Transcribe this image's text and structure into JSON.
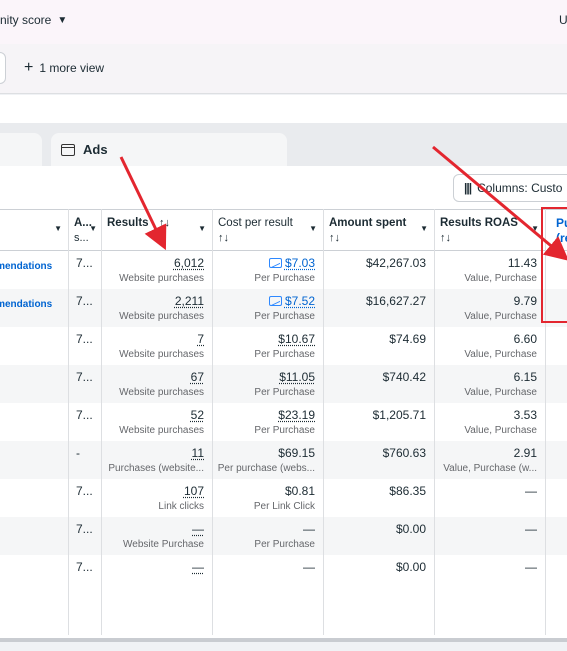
{
  "topbar": {
    "score_label": "nity score",
    "right_text": "U"
  },
  "views": {
    "more_views": "1 more view"
  },
  "tabs": {
    "ads_label": "Ads"
  },
  "toolbar": {
    "columns_label": "Columns: Custo"
  },
  "columns": [
    {
      "key": "name",
      "label": ""
    },
    {
      "key": "a",
      "label": "A...",
      "sub": "s..."
    },
    {
      "key": "results",
      "label": "Results",
      "sort": "↑↓"
    },
    {
      "key": "cpr",
      "label": "Cost per result",
      "sort": "↑↓"
    },
    {
      "key": "spent",
      "label": "Amount spent",
      "sort": "↑↓"
    },
    {
      "key": "roas",
      "label": "Results ROAS",
      "sort": "↑↓"
    },
    {
      "key": "pu",
      "label": "Pu",
      "sub": "(re"
    }
  ],
  "rows": [
    {
      "rec": "nmendations",
      "a": "7...",
      "results": "6,012",
      "results_sub": "Website purchases",
      "cpr": "$7.03",
      "cpr_sub": "Per Purchase",
      "cpr_link": true,
      "spent": "$42,267.03",
      "roas": "11.43",
      "roas_sub": "Value, Purchase"
    },
    {
      "rec": "nmendations",
      "a": "7...",
      "results": "2,211",
      "results_sub": "Website purchases",
      "cpr": "$7.52",
      "cpr_sub": "Per Purchase",
      "cpr_link": true,
      "spent": "$16,627.27",
      "roas": "9.79",
      "roas_sub": "Value, Purchase"
    },
    {
      "rec": "",
      "a": "7...",
      "results": "7",
      "results_sub": "Website purchases",
      "cpr": "$10.67",
      "cpr_sub": "Per Purchase",
      "spent": "$74.69",
      "roas": "6.60",
      "roas_sub": "Value, Purchase"
    },
    {
      "rec": "",
      "a": "7...",
      "results": "67",
      "results_sub": "Website purchases",
      "cpr": "$11.05",
      "cpr_sub": "Per Purchase",
      "spent": "$740.42",
      "roas": "6.15",
      "roas_sub": "Value, Purchase"
    },
    {
      "rec": "",
      "a": "7...",
      "results": "52",
      "results_sub": "Website purchases",
      "cpr": "$23.19",
      "cpr_sub": "Per Purchase",
      "spent": "$1,205.71",
      "roas": "3.53",
      "roas_sub": "Value, Purchase"
    },
    {
      "rec": "",
      "a": "-",
      "results": "11",
      "results_sub": "Purchases (website...",
      "cpr": "$69.15",
      "cpr_sub": "Per purchase (webs...",
      "spent": "$760.63",
      "roas": "2.91",
      "roas_sub": "Value, Purchase (w..."
    },
    {
      "rec": "",
      "a": "7...",
      "results": "107",
      "results_sub": "Link clicks",
      "cpr": "$0.81",
      "cpr_sub": "Per Link Click",
      "spent": "$86.35",
      "roas": "—",
      "roas_sub": ""
    },
    {
      "rec": "",
      "a": "7...",
      "results": "—",
      "results_sub": "Website Purchase",
      "cpr": "—",
      "cpr_sub": "Per Purchase",
      "spent": "$0.00",
      "roas": "—",
      "roas_sub": ""
    },
    {
      "rec": "",
      "a": "7...",
      "results": "—",
      "results_sub": "",
      "cpr": "—",
      "cpr_sub": "",
      "spent": "$0.00",
      "roas": "—",
      "roas_sub": ""
    }
  ],
  "colors": {
    "annotation_red": "#e3262f",
    "link_blue": "#0064d1"
  },
  "icons": [
    "caret-down-icon",
    "plus-icon",
    "ads-panel-icon",
    "columns-icon",
    "trend-icon",
    "sort-icon"
  ]
}
